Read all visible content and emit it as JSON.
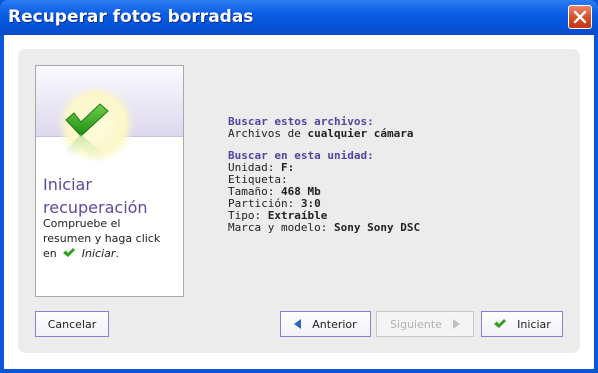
{
  "window": {
    "title": "Recuperar fotos borradas"
  },
  "card": {
    "heading_line1": "Iniciar",
    "heading_line2": "recuperación",
    "desc_line1": "Compruebe el",
    "desc_line2": "resumen y haga click",
    "desc_en": "en",
    "desc_action": "Iniciar",
    "desc_end": "."
  },
  "summary": {
    "files_title": "Buscar estos archivos:",
    "files_prefix": "Archivos de",
    "files_value": "cualquier cámara",
    "drive_title": "Buscar en esta unidad:",
    "rows": [
      {
        "label": "Unidad:",
        "value": "F:"
      },
      {
        "label": "Etiqueta:",
        "value": ""
      },
      {
        "label": "Tamaño:",
        "value": "468 Mb"
      },
      {
        "label": "Partición:",
        "value": "3:0"
      },
      {
        "label": "Tipo:",
        "value": "Extraíble"
      },
      {
        "label": "Marca y modelo:",
        "value": "Sony Sony DSC"
      }
    ]
  },
  "buttons": {
    "cancel": "Cancelar",
    "previous": "Anterior",
    "next": "Siguiente",
    "start": "Iniciar"
  },
  "colors": {
    "accent": "#5a4aa0",
    "button_border": "#8f7ccc",
    "check_green": "#2f9e1e",
    "title_bar": "#0553d8"
  }
}
